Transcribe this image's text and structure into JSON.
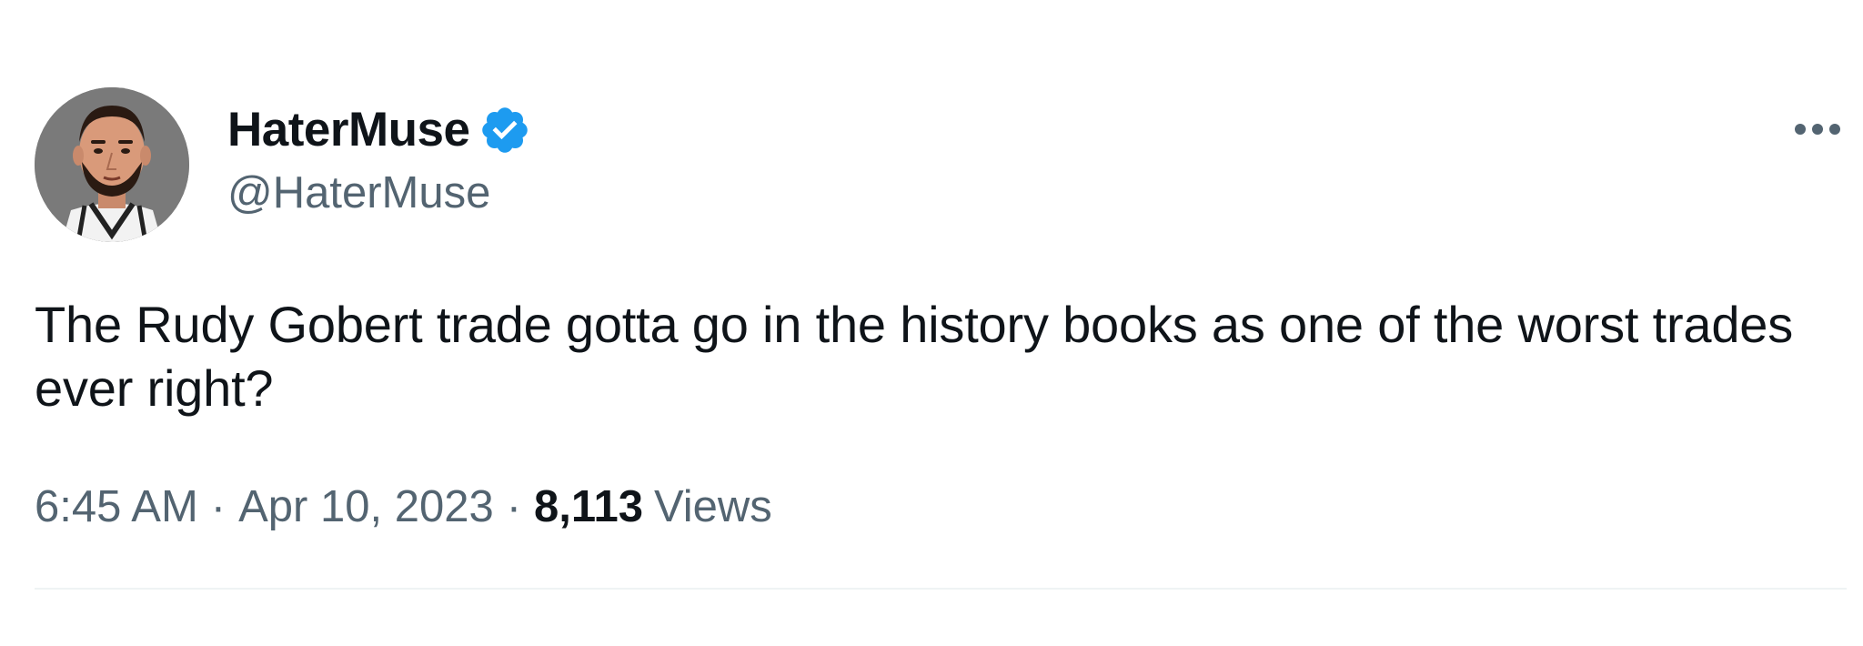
{
  "author": {
    "display_name": "HaterMuse",
    "handle": "@HaterMuse",
    "verified": true,
    "avatar_icon": "cartoon-player-avatar",
    "verified_badge_color": "#1d9bf0"
  },
  "tweet": {
    "text": "The Rudy Gobert trade gotta go in the history books as one of the worst trades ever right?",
    "time": "6:45 AM",
    "separator": "·",
    "date": "Apr 10, 2023",
    "views_count": "8,113",
    "views_label": "Views"
  },
  "actions": {
    "more_icon": "more-horizontal-icon"
  },
  "colors": {
    "text_primary": "#0f1419",
    "text_secondary": "#536471",
    "divider": "#eff3f4"
  }
}
